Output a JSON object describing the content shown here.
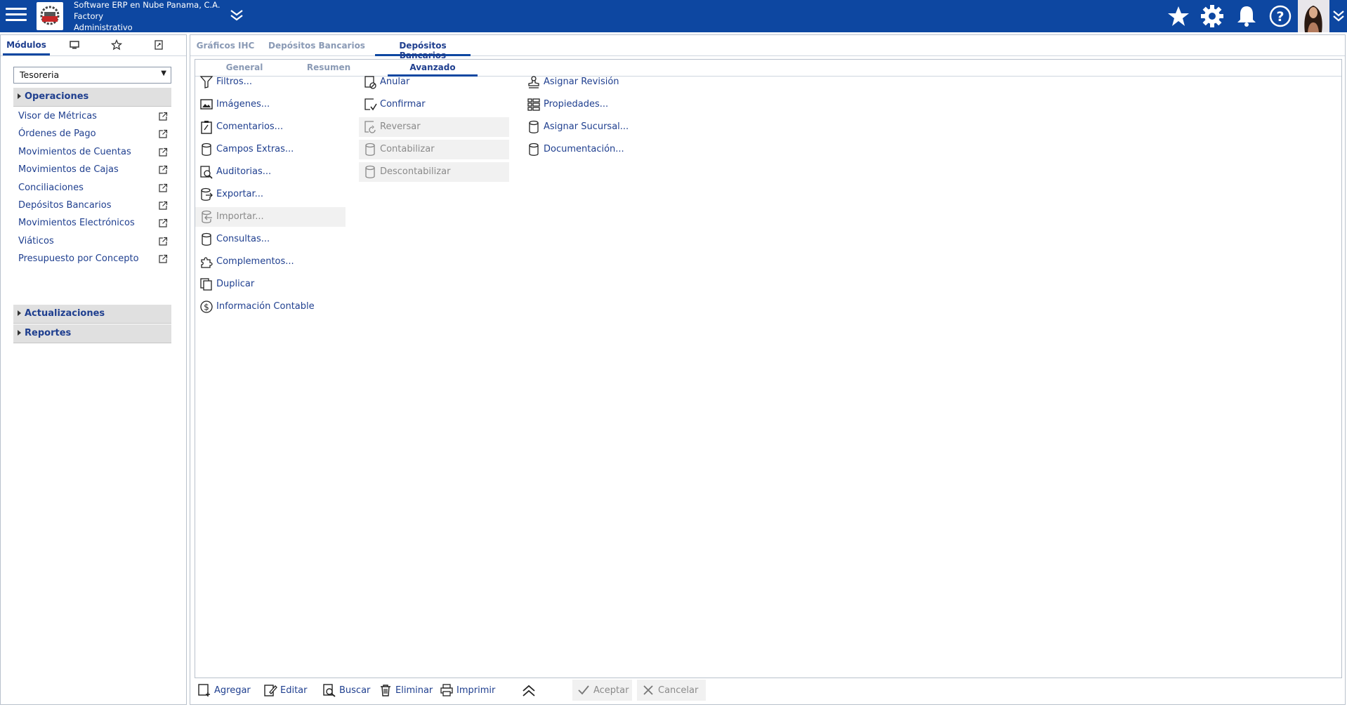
{
  "header": {
    "company_line1": "Software ERP en Nube Panama, C.A.",
    "company_line2": "Factory",
    "company_line3": "Administrativo",
    "icons": [
      "menu-icon",
      "logo",
      "chevron-down-icon",
      "star-icon",
      "gear-icon",
      "bell-icon",
      "help-icon",
      "avatar",
      "chevron-down-icon"
    ]
  },
  "left": {
    "tabs": [
      "Módulos",
      "monitor-icon",
      "star-icon",
      "link-icon"
    ],
    "module_select": "Tesoreria",
    "group_operaciones": "Operaciones",
    "items": [
      "Visor de Métricas",
      "Órdenes de Pago",
      "Movimientos de Cuentas",
      "Movimientos de Cajas",
      "Conciliaciones",
      "Depósitos Bancarios",
      "Movimientos Electrónicos",
      "Viáticos",
      "Presupuesto por Concepto"
    ],
    "group_actualizaciones": "Actualizaciones",
    "group_reportes": "Reportes"
  },
  "main": {
    "tabs": [
      "Gráficos IHC",
      "Depósitos Bancarios",
      "Depósitos Bancarios"
    ],
    "inner_tabs": [
      "General",
      "Resumen",
      "Avanzado"
    ],
    "col1": [
      "Filtros...",
      "Imágenes...",
      "Comentarios...",
      "Campos Extras...",
      "Auditorias...",
      "Exportar...",
      "Importar...",
      "Consultas...",
      "Complementos...",
      "Duplicar",
      "Información Contable"
    ],
    "col2": [
      "Anular",
      "Confirmar",
      "Reversar",
      "Contabilizar",
      "Descontabilizar"
    ],
    "col3": [
      "Asignar Revisión",
      "Propiedades...",
      "Asignar Sucursal...",
      "Documentación..."
    ]
  },
  "bottom": {
    "agregar": "Agregar",
    "editar": "Editar",
    "buscar": "Buscar",
    "eliminar": "Eliminar",
    "imprimir": "Imprimir",
    "aceptar": "Aceptar",
    "cancelar": "Cancelar"
  },
  "colors": {
    "header_bg": "#0d47a1",
    "link": "#1f3f8f",
    "disabled": "#8a8a8a"
  }
}
